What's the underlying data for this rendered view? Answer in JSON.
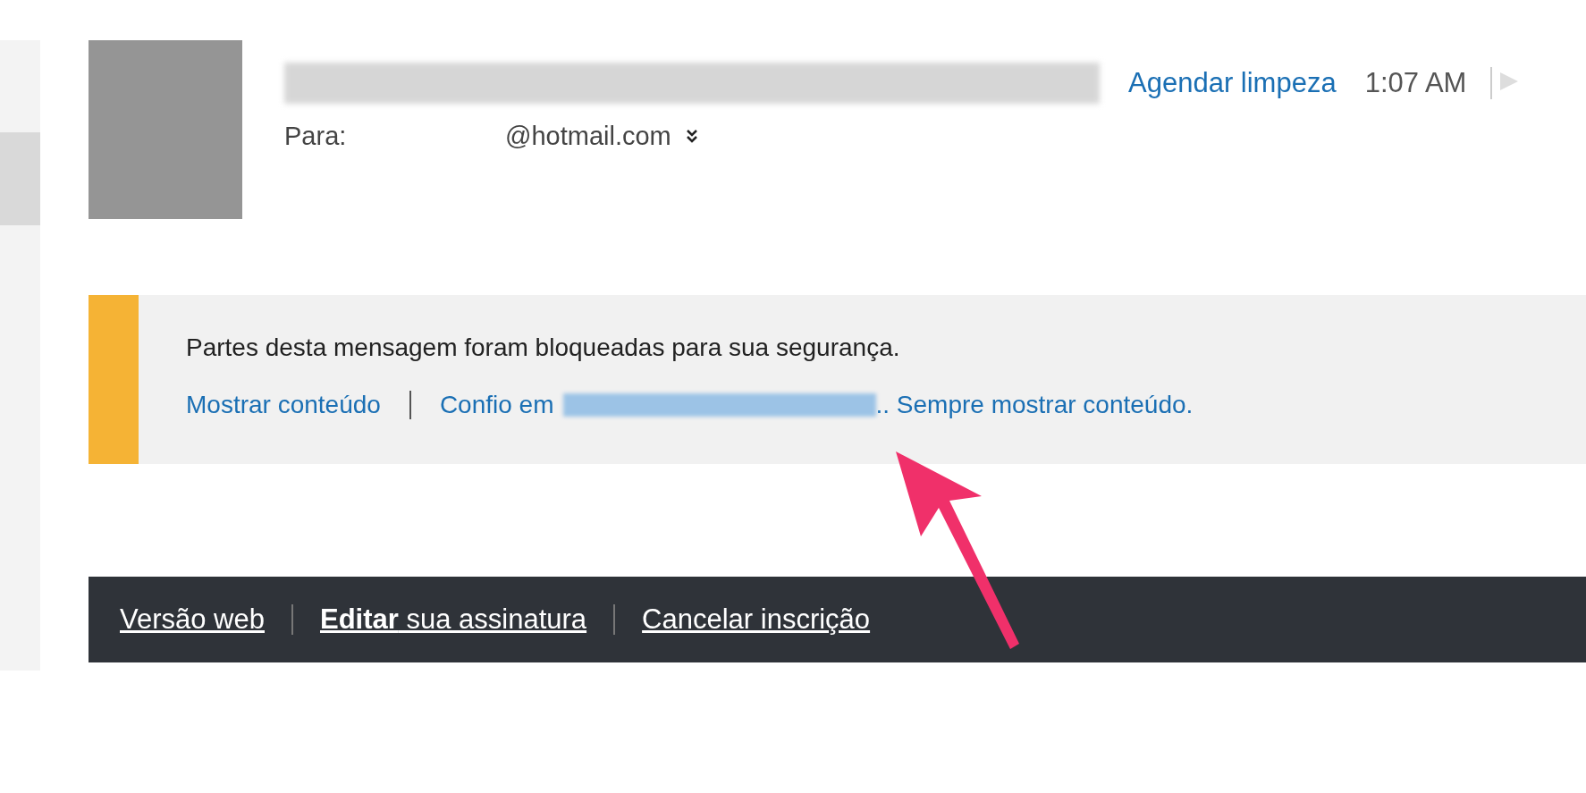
{
  "header": {
    "schedule_link": "Agendar limpeza",
    "time": "1:07 AM",
    "to_label": "Para:",
    "to_address": "@hotmail.com"
  },
  "notice": {
    "message": "Partes desta mensagem foram bloqueadas para sua segurança.",
    "show_link": "Mostrar conteúdo",
    "trust_prefix": "Confio em",
    "trust_suffix": ".. Sempre mostrar conteúdo."
  },
  "footer": {
    "links": [
      "Versão web",
      "**Editar** sua assinatura",
      "Cancelar inscrição"
    ]
  }
}
